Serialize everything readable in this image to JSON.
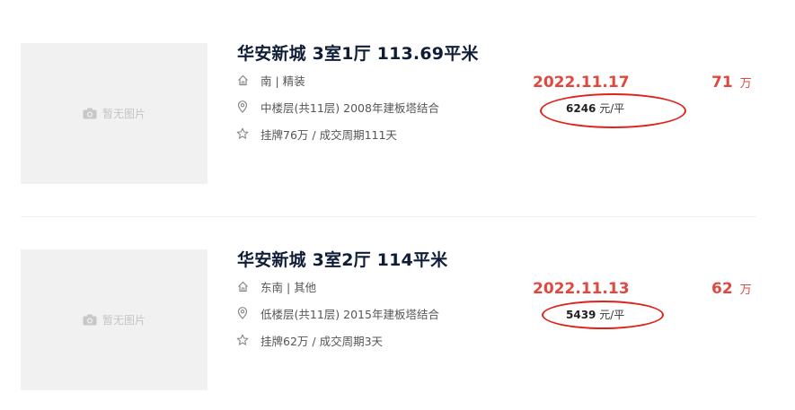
{
  "listings": [
    {
      "thumbnail_text": "暂无图片",
      "title": "华安新城 3室1厅 113.69平米",
      "orientation_decoration": "南 | 精装",
      "floor_info": "中楼层(共11层) 2008年建板塔结合",
      "listing_info": "挂牌76万 / 成交周期111天",
      "deal_date": "2022.11.17",
      "unit_price": "6246",
      "unit_price_unit": "元/平",
      "total_price": "71",
      "total_price_unit": "万"
    },
    {
      "thumbnail_text": "暂无图片",
      "title": "华安新城 3室2厅 114平米",
      "orientation_decoration": "东南 | 其他",
      "floor_info": "低楼层(共11层) 2015年建板塔结合",
      "listing_info": "挂牌62万 / 成交周期3天",
      "deal_date": "2022.11.13",
      "unit_price": "5439",
      "unit_price_unit": "元/平",
      "total_price": "62",
      "total_price_unit": "万"
    }
  ],
  "icons": {
    "thumbnail": "camera-icon",
    "house": "house-icon",
    "floor": "location-pin-icon",
    "listing": "star-icon"
  },
  "colors": {
    "title": "#101d37",
    "price_red": "#e0473f",
    "annotation_red": "#e0221b",
    "thumbnail_bg": "#f1f1f1"
  }
}
